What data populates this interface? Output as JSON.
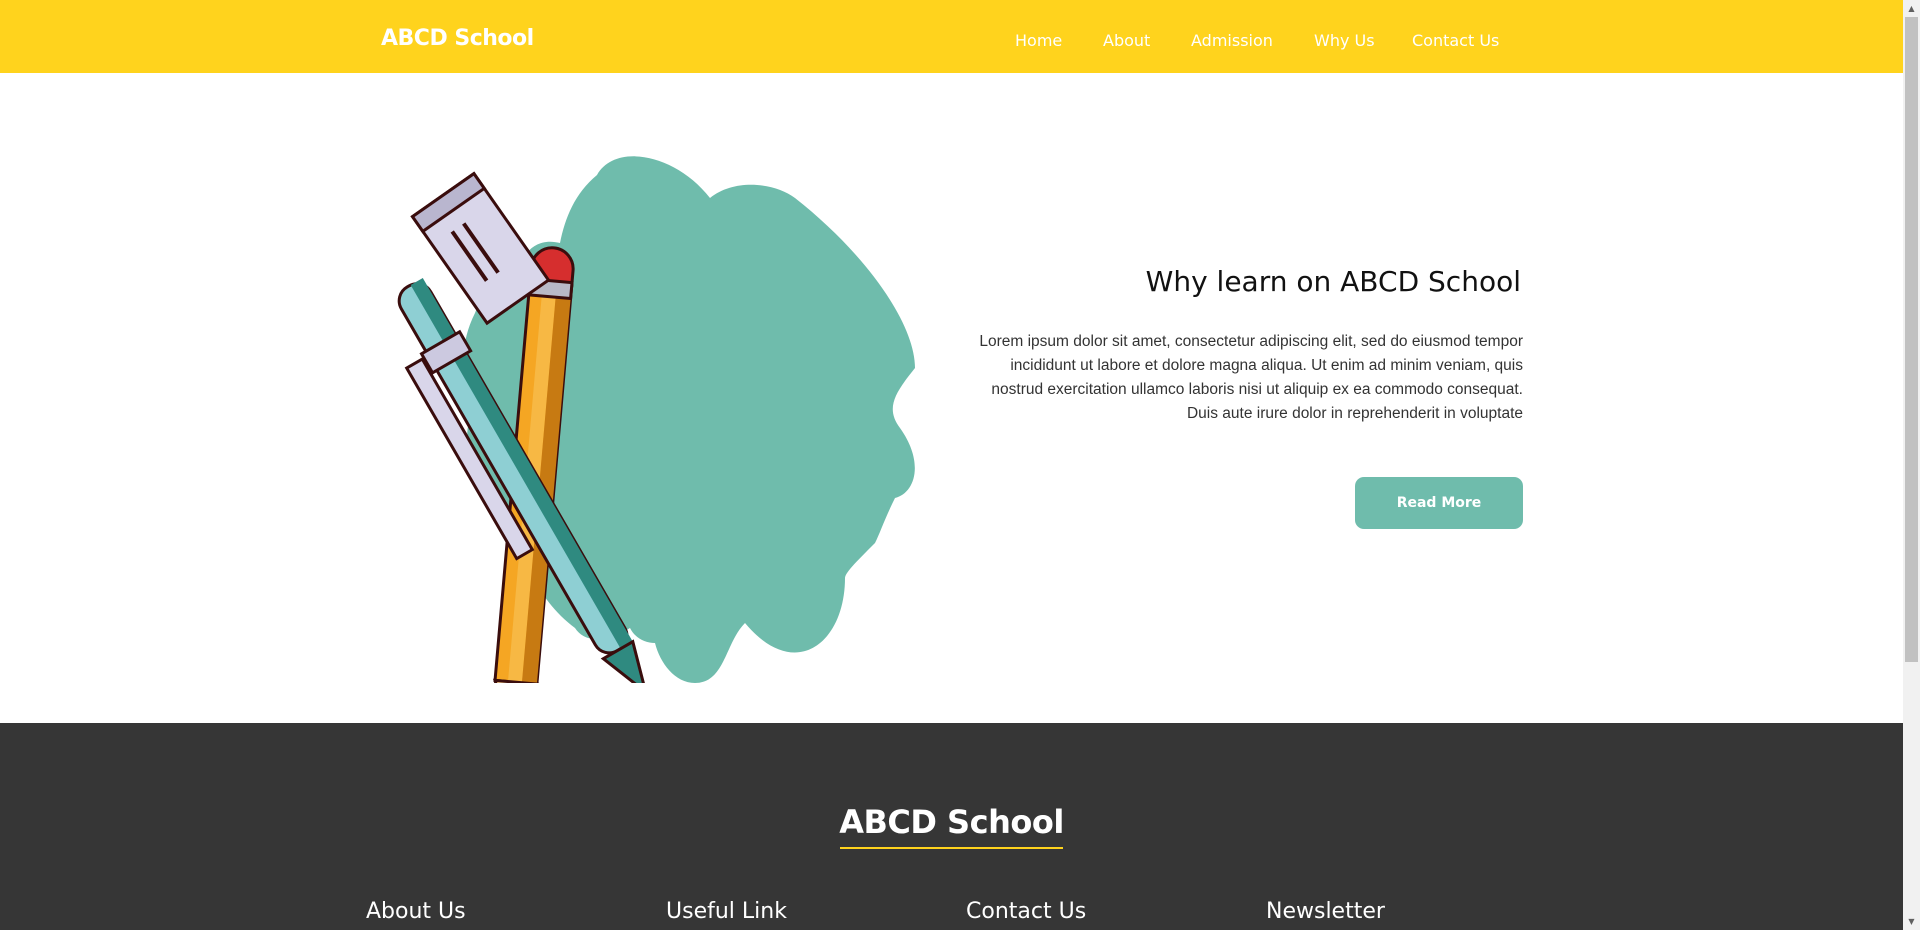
{
  "header": {
    "logo": "ABCD School",
    "nav": [
      "Home",
      "About",
      "Admission",
      "Why Us",
      "Contact Us"
    ]
  },
  "hero": {
    "title": "Why learn on ABCD School",
    "text": "Lorem ipsum dolor sit amet, consectetur adipiscing elit, sed do eiusmod tempor incididunt ut labore et dolore magna aliqua. Ut enim ad minim veniam, quis nostrud exercitation ullamco laboris nisi ut aliquip ex ea commodo consequat. Duis aute irure dolor in reprehenderit in voluptate",
    "button": "Read More",
    "illustration_icon": "pencil-and-pen-icon"
  },
  "footer": {
    "logo": "ABCD School",
    "columns": [
      "About Us",
      "Useful Link",
      "Contact Us",
      "Newsletter"
    ]
  },
  "colors": {
    "header_bg": "#ffd31d",
    "accent_teal": "#6fbcac",
    "footer_bg": "#363636"
  }
}
